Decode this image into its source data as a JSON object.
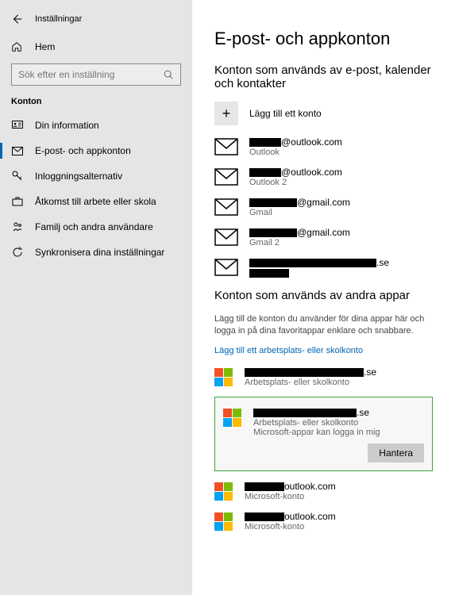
{
  "sidebar": {
    "title": "Inställningar",
    "home": "Hem",
    "search_placeholder": "Sök efter en inställning",
    "section": "Konton",
    "items": [
      {
        "label": "Din information"
      },
      {
        "label": "E-post- och appkonton"
      },
      {
        "label": "Inloggningsalternativ"
      },
      {
        "label": "Åtkomst till arbete eller skola"
      },
      {
        "label": "Familj och andra användare"
      },
      {
        "label": "Synkronisera dina inställningar"
      }
    ]
  },
  "main": {
    "heading": "E-post- och appkonton",
    "section1_title": "Konton som används av e-post, kalender och kontakter",
    "add_account": "Lägg till ett konto",
    "email_accounts": [
      {
        "suffix": "@outlook.com",
        "provider": "Outlook"
      },
      {
        "suffix": "@outlook.com",
        "provider": "Outlook 2"
      },
      {
        "suffix": "@gmail.com",
        "provider": "Gmail"
      },
      {
        "suffix": "@gmail.com",
        "provider": "Gmail 2"
      },
      {
        "suffix": ".se",
        "provider": ""
      }
    ],
    "section2_title": "Konton som används av andra appar",
    "section2_desc": "Lägg till de konton du använder för dina appar här och logga in på dina favoritappar enklare och snabbare.",
    "add_work_link": "Lägg till ett arbetsplats- eller skolkonto",
    "other_accounts": [
      {
        "suffix": ".se",
        "type": "Arbetsplats- eller skolkonto"
      }
    ],
    "selected_account": {
      "suffix": ".se",
      "type": "Arbetsplats- eller skolkonto",
      "sub": "Microsoft-appar kan logga in mig",
      "manage": "Hantera"
    },
    "ms_accounts": [
      {
        "suffix": "outlook.com",
        "type": "Microsoft-konto"
      },
      {
        "suffix": "outlook.com",
        "type": "Microsoft-konto"
      }
    ]
  }
}
